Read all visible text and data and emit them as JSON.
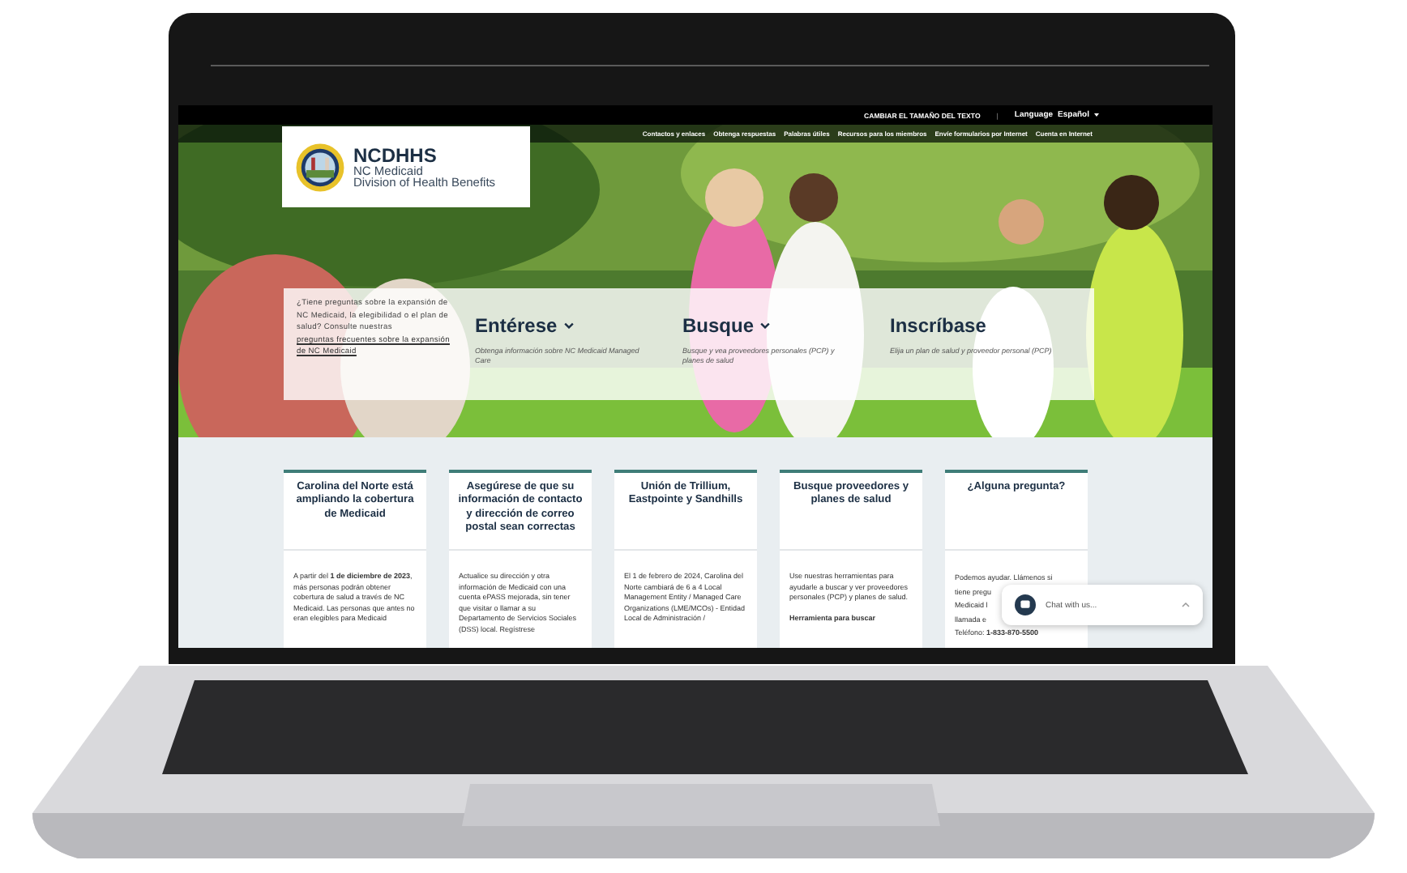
{
  "top_bar": {
    "text_size_link": "CAMBIAR EL TAMAÑO DEL TEXTO",
    "separator": "|",
    "language_label": "Language",
    "language_value": "Español"
  },
  "logo": {
    "title": "NCDHHS",
    "line_1": "NC Medicaid",
    "line_2": "Division of Health Benefits"
  },
  "nav": [
    "Contactos y enlaces",
    "Obtenga respuestas",
    "Palabras útiles",
    "Recursos para los miembros",
    "Envíe formularios por Internet",
    "Cuenta en Internet"
  ],
  "hero": {
    "kind": "picture",
    "question": {
      "text": "¿Tiene preguntas sobre la expansión de NC Medicaid, la elegibilidad o el plan de salud? Consulte nuestras",
      "link": "preguntas frecuentes sobre la expansión de NC Medicaid"
    },
    "actions": [
      {
        "title": "Entérese",
        "expandable": true,
        "description": "Obtenga información sobre NC Medicaid Managed Care"
      },
      {
        "title": "Busque",
        "expandable": true,
        "description": "Busque y vea proveedores personales (PCP) y planes de salud"
      },
      {
        "title": "Inscríbase",
        "expandable": false,
        "description": "Elija un plan de salud y proveedor personal (PCP)"
      }
    ]
  },
  "cards": [
    {
      "title": "Carolina del Norte está ampliando la cobertura de Medicaid",
      "paragraphs": [
        "A partir del **1 de diciembre de 2023**, más personas podrán obtener cobertura de salud a través de NC Medicaid. Las personas que antes no eran elegibles para Medicaid"
      ]
    },
    {
      "title": "Asegúrese de que su información de contacto y dirección de correo postal sean correctas",
      "paragraphs": [
        "Actualice su dirección y otra información de Medicaid con una cuenta ePASS mejorada, sin tener que visitar o llamar a su Departamento de Servicios Sociales (DSS) local. Regístrese"
      ]
    },
    {
      "title": "Unión de Trillium, Eastpointe y Sandhills",
      "paragraphs": [
        "El 1 de febrero de 2024, Carolina del Norte cambiará de 6 a 4 Local Management Entity / Managed Care Organizations (LME/MCOs) - Entidad Local de Administración /"
      ]
    },
    {
      "title": "Busque proveedores y planes de salud",
      "paragraphs": [
        "Use nuestras herramientas para ayudarle a buscar y ver proveedores personales (PCP) y planes de salud.",
        "**Herramienta para buscar**"
      ]
    },
    {
      "title": "¿Alguna pregunta?",
      "paragraphs": [
        "Podemos ayudar. Llámenos si",
        "tiene pregu",
        "Medicaid l",
        "llamada e",
        "Teléfono: **1-833-870-5500**"
      ]
    }
  ],
  "chat": {
    "label": "Chat with us..."
  }
}
